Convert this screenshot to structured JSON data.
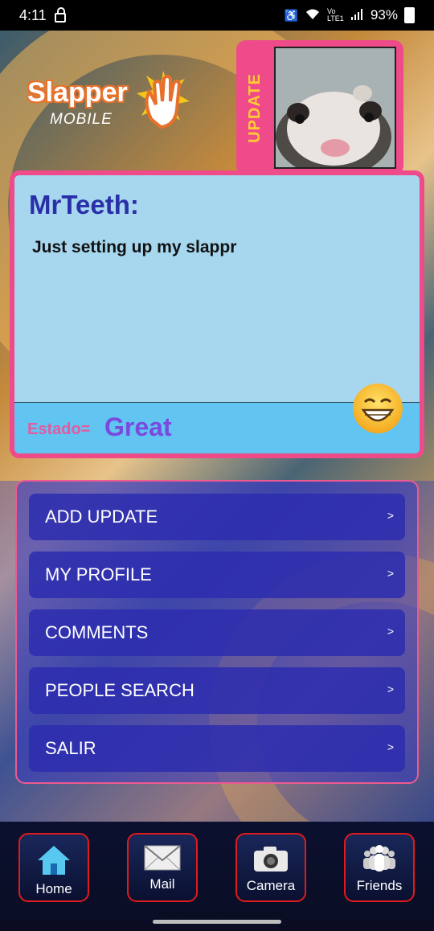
{
  "status_bar": {
    "time": "4:11",
    "battery": "93%",
    "network": "Vo LTE1"
  },
  "logo": {
    "title": "Slapper",
    "subtitle": "MOBILE"
  },
  "update_panel": {
    "label": "UPDATE"
  },
  "card": {
    "name": "MrTeeth:",
    "message": "Just setting up my slappr",
    "estado_label": "Estado=",
    "estado_value": "Great"
  },
  "menu": {
    "items": [
      {
        "label": "ADD UPDATE",
        "arrow": ">"
      },
      {
        "label": "MY PROFILE",
        "arrow": ">"
      },
      {
        "label": "COMMENTS",
        "arrow": ">"
      },
      {
        "label": "PEOPLE SEARCH",
        "arrow": ">"
      },
      {
        "label": "SALIR",
        "arrow": ">"
      }
    ]
  },
  "bottom_nav": {
    "items": [
      {
        "label": "Home",
        "icon": "home-icon"
      },
      {
        "label": "Mail",
        "icon": "mail-icon"
      },
      {
        "label": "Camera",
        "icon": "camera-icon"
      },
      {
        "label": "Friends",
        "icon": "friends-icon"
      }
    ]
  },
  "colors": {
    "accent_pink": "#ef4a8a",
    "card_blue": "#a6d7ee",
    "name_blue": "#2a2fa8",
    "estado_purple": "#7a4adf",
    "update_yellow": "#ffcc33",
    "nav_border_red": "#e01b1b"
  }
}
